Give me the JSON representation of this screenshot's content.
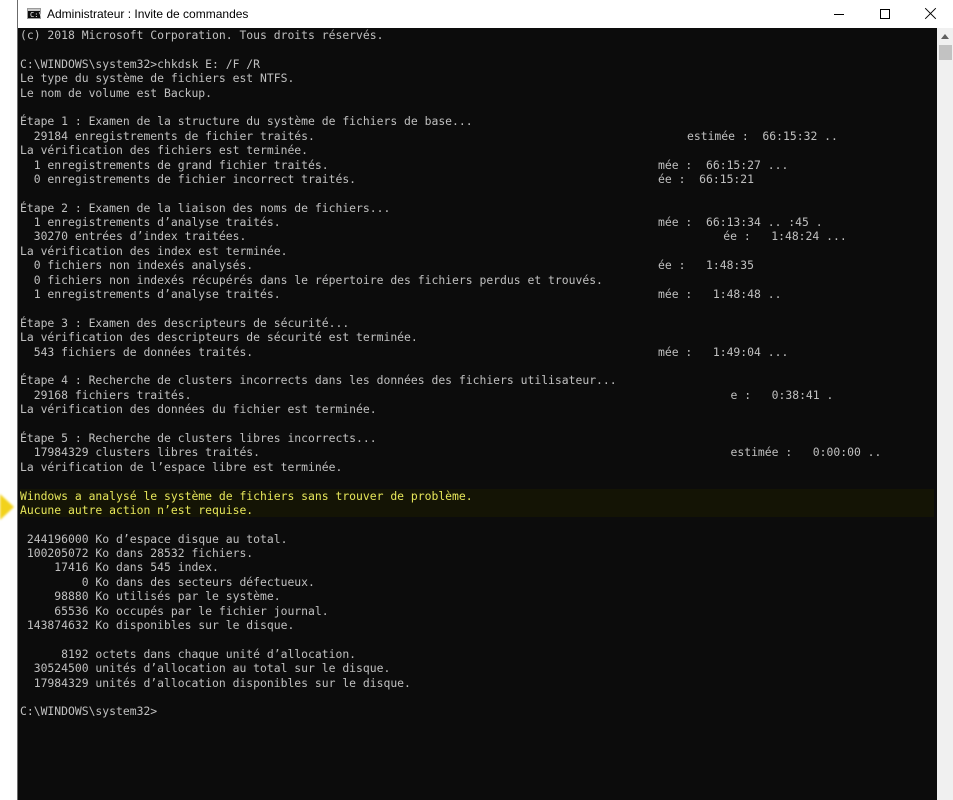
{
  "window": {
    "title": "Administrateur : Invite de commandes",
    "icon_label": "C:\\",
    "minimize_symbol": "",
    "maximize_symbol": "",
    "close_symbol": ""
  },
  "console": {
    "lines": [
      {
        "text": "(c) 2018 Microsoft Corporation. Tous droits réservés."
      },
      {
        "text": ""
      },
      {
        "text": "C:\\WINDOWS\\system32>chkdsk E: /F /R"
      },
      {
        "text": "Le type du système de fichiers est NTFS."
      },
      {
        "text": "Le nom de volume est Backup."
      },
      {
        "text": ""
      },
      {
        "text": "Étape 1 : Examen de la structure du système de fichiers de base..."
      },
      {
        "text": "  29184 enregistrements de fichier traités.",
        "right": "estimée :  66:15:32 ..",
        "right_col": 92
      },
      {
        "text": "La vérification des fichiers est terminée."
      },
      {
        "text": "  1 enregistrements de grand fichier traités.",
        "right": "mée :  66:15:27 ...",
        "right_col": 88
      },
      {
        "text": "  0 enregistrements de fichier incorrect traités.",
        "right": "ée :  66:15:21",
        "right_col": 88
      },
      {
        "text": ""
      },
      {
        "text": "Étape 2 : Examen de la liaison des noms de fichiers..."
      },
      {
        "text": "  1 enregistrements d’analyse traités.",
        "right": "mée :  66:13:34 .. :45 .",
        "right_col": 88
      },
      {
        "text": "  30270 entrées d’index traitées.",
        "right": "ée :   1:48:24 ...",
        "right_col": 97
      },
      {
        "text": "La vérification des index est terminée."
      },
      {
        "text": "  0 fichiers non indexés analysés.",
        "right": "ée :   1:48:35",
        "right_col": 88
      },
      {
        "text": "  0 fichiers non indexés récupérés dans le répertoire des fichiers perdus et trouvés."
      },
      {
        "text": "  1 enregistrements d’analyse traités.",
        "right": "mée :   1:48:48 ..",
        "right_col": 88
      },
      {
        "text": ""
      },
      {
        "text": "Étape 3 : Examen des descripteurs de sécurité..."
      },
      {
        "text": "La vérification des descripteurs de sécurité est terminée."
      },
      {
        "text": "  543 fichiers de données traités.",
        "right": "mée :   1:49:04 ...",
        "right_col": 88
      },
      {
        "text": ""
      },
      {
        "text": "Étape 4 : Recherche de clusters incorrects dans les données des fichiers utilisateur..."
      },
      {
        "text": "  29168 fichiers traités.",
        "right": "e :   0:38:41 .",
        "right_col": 98
      },
      {
        "text": "La vérification des données du fichier est terminée."
      },
      {
        "text": ""
      },
      {
        "text": "Étape 5 : Recherche de clusters libres incorrects..."
      },
      {
        "text": "  17984329 clusters libres traités.",
        "right": "estimée :   0:00:00 ..",
        "right_col": 98
      },
      {
        "text": "La vérification de l’espace libre est terminée."
      },
      {
        "text": ""
      },
      {
        "text": "Windows a analysé le système de fichiers sans trouver de problème.",
        "highlight": true
      },
      {
        "text": "Aucune autre action n’est requise.",
        "highlight": true
      },
      {
        "text": ""
      },
      {
        "text": " 244196000 Ko d’espace disque au total."
      },
      {
        "text": " 100205072 Ko dans 28532 fichiers."
      },
      {
        "text": "     17416 Ko dans 545 index."
      },
      {
        "text": "         0 Ko dans des secteurs défectueux."
      },
      {
        "text": "     98880 Ko utilisés par le système."
      },
      {
        "text": "     65536 Ko occupés par le fichier journal."
      },
      {
        "text": " 143874632 Ko disponibles sur le disque."
      },
      {
        "text": ""
      },
      {
        "text": "      8192 octets dans chaque unité d’allocation."
      },
      {
        "text": "  30524500 unités d’allocation au total sur le disque."
      },
      {
        "text": "  17984329 unités d’allocation disponibles sur le disque."
      },
      {
        "text": ""
      },
      {
        "text": "C:\\WINDOWS\\system32>"
      }
    ]
  },
  "colors": {
    "console_background": "#0c0c0c",
    "console_text": "#c0c0c0",
    "highlight_text": "#e6e65a",
    "marker": "#f2d21c"
  },
  "icons": {
    "app": "cmd-icon",
    "minimize": "minimize-icon",
    "maximize": "maximize-icon",
    "close": "close-icon",
    "scroll_up": "scroll-up-arrow-icon"
  }
}
